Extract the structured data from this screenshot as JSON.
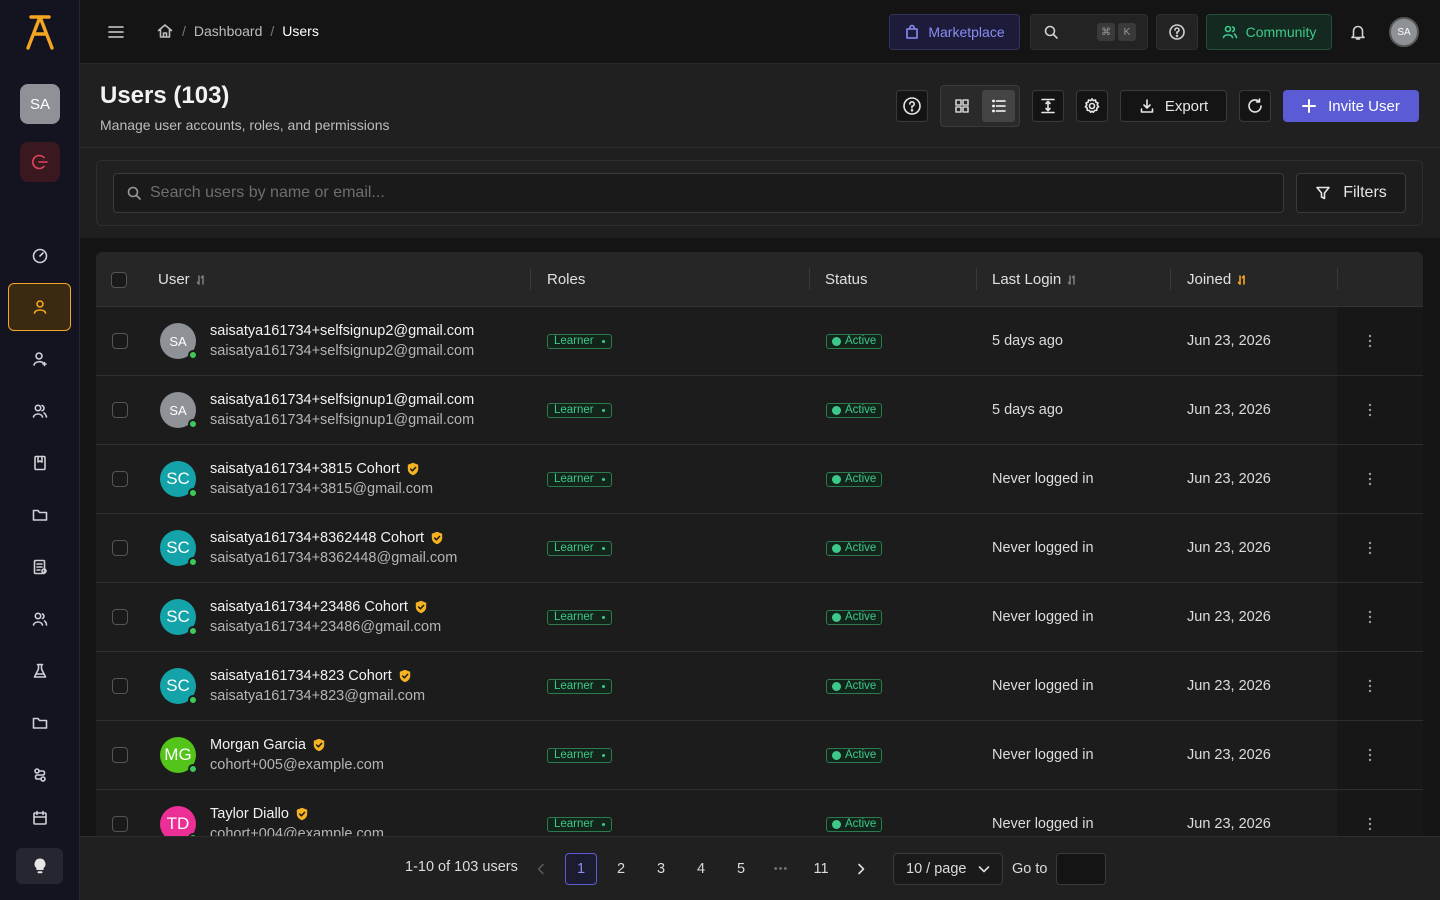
{
  "colors": {
    "accent": "#5b5bd6",
    "brand": "#f5a623",
    "success": "#3ec98a"
  },
  "rail": {
    "avatar_initials": "SA",
    "items": [
      {
        "icon": "dashboard-icon"
      },
      {
        "icon": "user-icon",
        "active": true
      },
      {
        "icon": "user-check-icon"
      },
      {
        "icon": "users-icon"
      },
      {
        "icon": "book-icon"
      },
      {
        "icon": "folder-icon"
      },
      {
        "icon": "report-icon"
      },
      {
        "icon": "team-icon"
      },
      {
        "icon": "flask-icon"
      },
      {
        "icon": "folder-icon"
      },
      {
        "icon": "workflow-icon"
      },
      {
        "icon": "calendar-icon"
      }
    ]
  },
  "topbar": {
    "breadcrumb": {
      "items": [
        "Dashboard",
        "Users"
      ],
      "separator": "/"
    },
    "marketplace_label": "Marketplace",
    "search_shortcut": [
      "⌘",
      "K"
    ],
    "community_label": "Community",
    "avatar_initials": "SA"
  },
  "header": {
    "title": "Users (103)",
    "subtitle": "Manage user accounts, roles, and permissions",
    "export_label": "Export",
    "invite_label": "Invite User"
  },
  "search": {
    "placeholder": "Search users by name or email...",
    "value": "",
    "filters_label": "Filters"
  },
  "table": {
    "columns": {
      "user": "User",
      "roles": "Roles",
      "status": "Status",
      "last_login": "Last Login",
      "joined": "Joined"
    },
    "rows": [
      {
        "initials": "SA",
        "avatar_color": "#8e9196",
        "name": "saisatya161734+selfsignup2@gmail.com",
        "email": "saisatya161734+selfsignup2@gmail.com",
        "verified": false,
        "role": "Learner",
        "status": "Active",
        "last_login": "5 days ago",
        "joined": "Jun 23, 2026"
      },
      {
        "initials": "SA",
        "avatar_color": "#8e9196",
        "name": "saisatya161734+selfsignup1@gmail.com",
        "email": "saisatya161734+selfsignup1@gmail.com",
        "verified": false,
        "role": "Learner",
        "status": "Active",
        "last_login": "5 days ago",
        "joined": "Jun 23, 2026"
      },
      {
        "initials": "SC",
        "avatar_color": "#14a3a8",
        "name": "saisatya161734+3815 Cohort",
        "email": "saisatya161734+3815@gmail.com",
        "verified": true,
        "role": "Learner",
        "status": "Active",
        "last_login": "Never logged in",
        "joined": "Jun 23, 2026"
      },
      {
        "initials": "SC",
        "avatar_color": "#14a3a8",
        "name": "saisatya161734+8362448 Cohort",
        "email": "saisatya161734+8362448@gmail.com",
        "verified": true,
        "role": "Learner",
        "status": "Active",
        "last_login": "Never logged in",
        "joined": "Jun 23, 2026"
      },
      {
        "initials": "SC",
        "avatar_color": "#14a3a8",
        "name": "saisatya161734+23486 Cohort",
        "email": "saisatya161734+23486@gmail.com",
        "verified": true,
        "role": "Learner",
        "status": "Active",
        "last_login": "Never logged in",
        "joined": "Jun 23, 2026"
      },
      {
        "initials": "SC",
        "avatar_color": "#14a3a8",
        "name": "saisatya161734+823 Cohort",
        "email": "saisatya161734+823@gmail.com",
        "verified": true,
        "role": "Learner",
        "status": "Active",
        "last_login": "Never logged in",
        "joined": "Jun 23, 2026"
      },
      {
        "initials": "MG",
        "avatar_color": "#52c41a",
        "name": "Morgan Garcia",
        "email": "cohort+005@example.com",
        "verified": true,
        "role": "Learner",
        "status": "Active",
        "last_login": "Never logged in",
        "joined": "Jun 23, 2026"
      },
      {
        "initials": "TD",
        "avatar_color": "#eb2f96",
        "name": "Taylor Diallo",
        "email": "cohort+004@example.com",
        "verified": true,
        "role": "Learner",
        "status": "Active",
        "last_login": "Never logged in",
        "joined": "Jun 23, 2026"
      }
    ]
  },
  "pagination": {
    "range_text": "1-10 of 103 users",
    "pages": [
      "1",
      "2",
      "3",
      "4",
      "5"
    ],
    "ellipsis": "•••",
    "last_page": "11",
    "current_page": "1",
    "page_size": "10 / page",
    "goto_label": "Go to",
    "goto_value": ""
  }
}
